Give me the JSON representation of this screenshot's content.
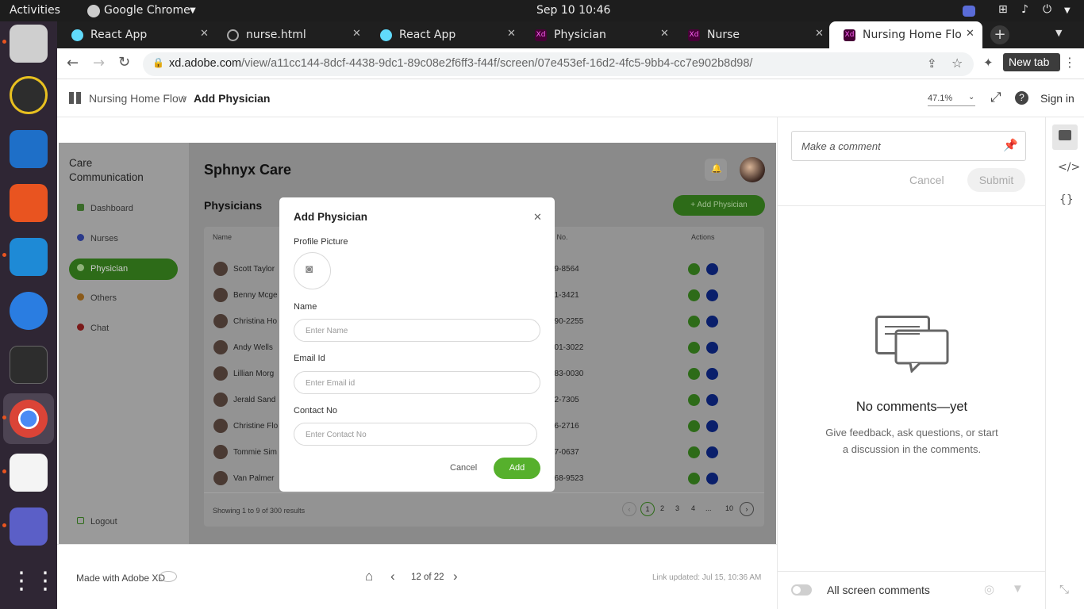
{
  "system": {
    "activities": "Activities",
    "app_menu": "Google Chrome",
    "datetime": "Sep 10  10:46"
  },
  "tabs": [
    {
      "label": "React App"
    },
    {
      "label": "nurse.html"
    },
    {
      "label": "React App"
    },
    {
      "label": "Physician"
    },
    {
      "label": "Nurse"
    },
    {
      "label": "Nursing Home Flow"
    }
  ],
  "browser": {
    "url_host": "xd.adobe.com",
    "url_path": "/view/a11cc144-8dcf-4438-9dc1-89c08e2f6ff3-f44f/screen/07e453ef-16d2-4fc5-9bb4-cc7e902b8d98/",
    "new_tab_tooltip": "New tab"
  },
  "xd_header": {
    "breadcrumb_root": "Nursing Home Flow",
    "breadcrumb_current": "Add Physician",
    "zoom": "47.1%",
    "sign_in": "Sign in"
  },
  "app": {
    "brand_line1": "Care",
    "brand_line2": "Communication",
    "title": "Sphnyx Care",
    "section": "Physicians",
    "add_button": "+ Add Physician",
    "nav": [
      {
        "label": "Dashboard"
      },
      {
        "label": "Nurses"
      },
      {
        "label": "Physician"
      },
      {
        "label": "Others"
      },
      {
        "label": "Chat"
      }
    ],
    "logout": "Logout",
    "columns": {
      "name": "Name",
      "contact": "act No.",
      "actions": "Actions"
    },
    "rows": [
      {
        "name": "Scott Taylor",
        "contact": "59-8564"
      },
      {
        "name": "Benny Mcge",
        "contact": "21-3421"
      },
      {
        "name": "Christina Ho",
        "contact": "390-2255"
      },
      {
        "name": "Andy Wells",
        "contact": "201-3022"
      },
      {
        "name": "Lillian Morg",
        "contact": "583-0030"
      },
      {
        "name": "Jerald Sand",
        "contact": "32-7305"
      },
      {
        "name": "Christine Flo",
        "contact": "56-2716"
      },
      {
        "name": "Tommie Sim",
        "contact": "67-0637"
      },
      {
        "name": "Van Palmer",
        "contact": "268-9523"
      }
    ],
    "showing": "Showing 1 to 9 of 300 results",
    "pages": [
      "1",
      "2",
      "3",
      "4",
      "...",
      "10"
    ]
  },
  "modal": {
    "title": "Add Physician",
    "profile_label": "Profile Picture",
    "name_label": "Name",
    "name_placeholder": "Enter Name",
    "email_label": "Email Id",
    "email_placeholder": "Enter Email id",
    "contact_label": "Contact No",
    "contact_placeholder": "Enter Contact No",
    "cancel": "Cancel",
    "add": "Add"
  },
  "bottom": {
    "made_with": "Made with Adobe XD",
    "page_indicator": "12 of 22",
    "link_updated": "Link updated: Jul 15, 10:36 AM"
  },
  "comments": {
    "placeholder": "Make a comment",
    "cancel": "Cancel",
    "submit": "Submit",
    "empty_title": "No comments—yet",
    "empty_text": "Give feedback, ask questions, or start a discussion in the comments.",
    "all_screen": "All screen comments"
  },
  "colors": {
    "accent_green": "#56b02c",
    "chrome_dark": "#1f1f1f",
    "dock": "#2f2634"
  }
}
